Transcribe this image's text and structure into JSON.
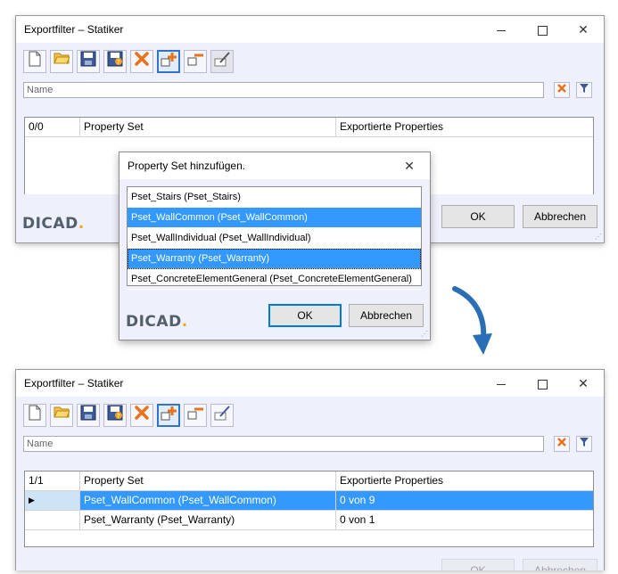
{
  "window_top": {
    "title": "Exportfilter – Statiker",
    "name_placeholder": "Name",
    "grid": {
      "headers": [
        "0/0",
        "Property Set",
        "Exportierte Properties"
      ]
    },
    "ok_label": "OK",
    "cancel_label": "Abbrechen",
    "logo_text": "DICAD"
  },
  "dialog": {
    "title": "Property Set hinzufügen.",
    "items": [
      {
        "label": "Pset_Stairs (Pset_Stairs)",
        "selected": false
      },
      {
        "label": "Pset_WallCommon (Pset_WallCommon)",
        "selected": true
      },
      {
        "label": "Pset_WallIndividual (Pset_WallIndividual)",
        "selected": false
      },
      {
        "label": "Pset_Warranty (Pset_Warranty)",
        "selected": true
      },
      {
        "label": "Pset_ConcreteElementGeneral (Pset_ConcreteElementGeneral)",
        "selected": false
      }
    ],
    "ok_label": "OK",
    "cancel_label": "Abbrechen",
    "logo_text": "DICAD"
  },
  "window_bottom": {
    "title": "Exportfilter – Statiker",
    "name_placeholder": "Name",
    "grid": {
      "headers": [
        "1/1",
        "Property Set",
        "Exportierte Properties"
      ],
      "rows": [
        {
          "indicator": "▶",
          "property_set": "Pset_WallCommon (Pset_WallCommon)",
          "exported": "0 von 9",
          "selected": true
        },
        {
          "indicator": "",
          "property_set": "Pset_Warranty (Pset_Warranty)",
          "exported": "0 von 1",
          "selected": false
        }
      ]
    },
    "ok_label": "OK",
    "cancel_label": "Abbrechen"
  },
  "toolbar_icons": [
    "new-document-icon",
    "open-folder-icon",
    "save-icon",
    "save-as-icon",
    "delete-icon",
    "add-property-set-icon",
    "remove-property-set-icon",
    "edit-icon"
  ],
  "colors": {
    "selection": "#3399ff",
    "accent_border": "#0078d7",
    "logo_dot": "#f2a31b",
    "arrow": "#2a6fb5"
  }
}
